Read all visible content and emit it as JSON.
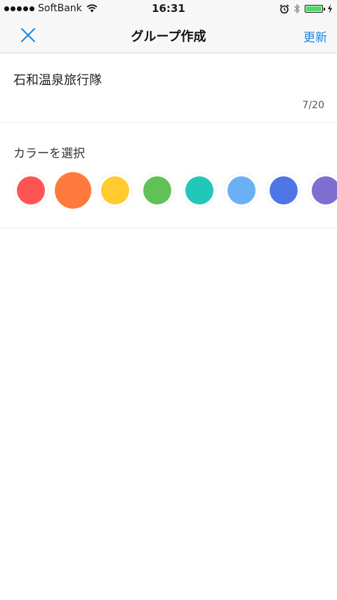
{
  "status_bar": {
    "carrier": "SoftBank",
    "time": "16:31",
    "battery_level": 1.0
  },
  "nav": {
    "title": "グループ作成",
    "update_label": "更新"
  },
  "group": {
    "name": "石和温泉旅行隊",
    "char_count": "7/20"
  },
  "color_picker": {
    "label": "カラーを選択",
    "selected_index": 1,
    "colors": [
      "#ff5454",
      "#ff7a3d",
      "#ffcb2e",
      "#60c157",
      "#22c7b9",
      "#6bb0f5",
      "#4f76e6",
      "#7f6fd0"
    ]
  },
  "theme": {
    "accent": "#1a86e0"
  }
}
